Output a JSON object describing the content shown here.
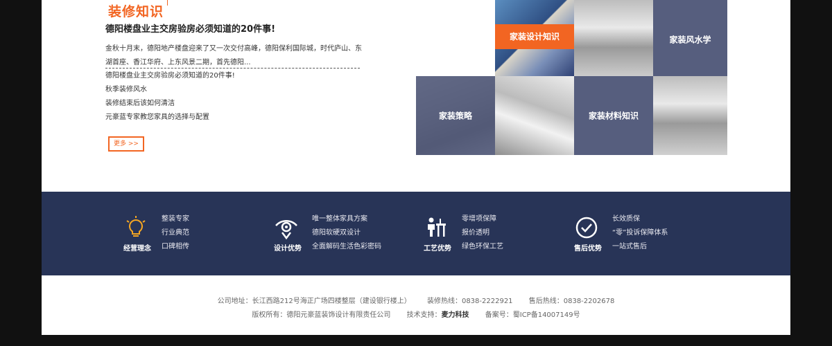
{
  "knowledge": {
    "title": "装修知识",
    "headline": "德阳楼盘业主交房验房必须知道的20件事!",
    "summary": "金秋十月末，德阳地产楼盘迎来了又一次交付高峰，德阳保利国际城，时代庐山、东湖首座、香江华府、上东风景二期，首先德阳...",
    "articles": [
      "德阳楼盘业主交房验房必须知道的20件事!",
      "秋季装修风水",
      "装修结束后该如何清洁",
      "元豪蓝专家教您家具的选择与配置"
    ],
    "more_label": "更多 >>"
  },
  "tiles": {
    "design": "家装设计知识",
    "fengshui": "家装风水学",
    "strategy": "家装策略",
    "materials": "家装材料知识"
  },
  "features": [
    {
      "icon": "bulb-icon",
      "title": "经营理念",
      "items": [
        "整装专家",
        "行业典范",
        "口碑相传"
      ]
    },
    {
      "icon": "eye-icon",
      "title": "设计优势",
      "items": [
        "唯一整体家具方案",
        "德阳软硬双设计",
        "全面解码生活色彩密码"
      ]
    },
    {
      "icon": "worker-icon",
      "title": "工艺优势",
      "items": [
        "零增项保障",
        "报价透明",
        "绿色环保工艺"
      ]
    },
    {
      "icon": "check-icon",
      "title": "售后优势",
      "items": [
        "长效质保",
        "“零”投诉保障体系",
        "一站式售后"
      ]
    }
  ],
  "footer": {
    "address": "公司地址：长江西路212号海正广场四楼整层（建设银行楼上）",
    "decor_hotline": "装修热线：0838-2222921",
    "service_hotline": "售后热线：0838-2202678",
    "copyright": "版权所有：德阳元豪蓝装饰设计有限责任公司",
    "tech_label": "技术支持：",
    "tech_name": "麦力科技",
    "icp": "备案号：蜀ICP备14007149号"
  },
  "colors": {
    "accent": "#f26522",
    "navy": "#283457",
    "tile": "#565e7e"
  }
}
